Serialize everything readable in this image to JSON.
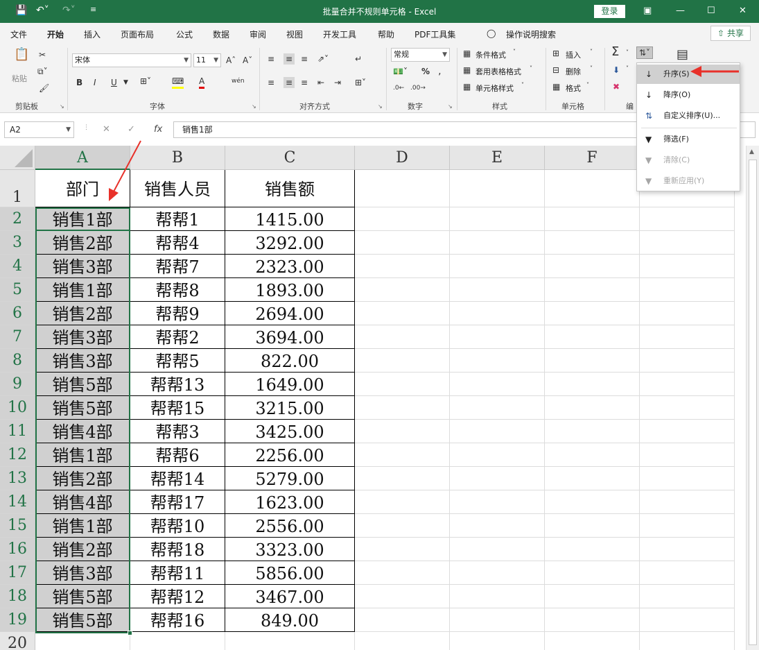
{
  "titlebar": {
    "title": "批量合并不规则单元格  -  Excel",
    "login": "登录"
  },
  "menu": {
    "tabs": [
      "文件",
      "开始",
      "插入",
      "页面布局",
      "公式",
      "数据",
      "审阅",
      "视图",
      "开发工具",
      "帮助",
      "PDF工具集"
    ],
    "tell_me": "操作说明搜索",
    "share": "共享"
  },
  "ribbon": {
    "clipboard": {
      "paste": "粘贴",
      "label": "剪贴板"
    },
    "font": {
      "name": "宋体",
      "size": "11",
      "label": "字体",
      "bold": "B",
      "italic": "I",
      "underline": "U"
    },
    "alignment": {
      "label": "对齐方式"
    },
    "number": {
      "format": "常规",
      "label": "数字",
      "percent": "%"
    },
    "styles": {
      "conditional": "条件格式",
      "table": "套用表格格式",
      "cell": "单元格样式",
      "label": "样式"
    },
    "cells": {
      "insert": "插入",
      "delete": "删除",
      "format": "格式",
      "label": "单元格"
    },
    "editing": {
      "label": "编"
    }
  },
  "formula_bar": {
    "cell_ref": "A2",
    "fx": "fx",
    "content": "销售1部"
  },
  "sort_menu": {
    "ascending": "升序(S)",
    "descending": "降序(O)",
    "custom": "自定义排序(U)...",
    "filter": "筛选(F)",
    "clear": "清除(C)",
    "reapply": "重新应用(Y)"
  },
  "sheet": {
    "columns": [
      "A",
      "B",
      "C",
      "D",
      "E",
      "F"
    ],
    "row_numbers": [
      "1",
      "2",
      "3",
      "4",
      "5",
      "6",
      "7",
      "8",
      "9",
      "10",
      "11",
      "12",
      "13",
      "14",
      "15",
      "16",
      "17",
      "18",
      "19",
      "20"
    ],
    "header": [
      "部门",
      "销售人员",
      "销售额"
    ],
    "rows": [
      [
        "销售1部",
        "帮帮1",
        "1415.00"
      ],
      [
        "销售2部",
        "帮帮4",
        "3292.00"
      ],
      [
        "销售3部",
        "帮帮7",
        "2323.00"
      ],
      [
        "销售1部",
        "帮帮8",
        "1893.00"
      ],
      [
        "销售2部",
        "帮帮9",
        "2694.00"
      ],
      [
        "销售3部",
        "帮帮2",
        "3694.00"
      ],
      [
        "销售3部",
        "帮帮5",
        "822.00"
      ],
      [
        "销售5部",
        "帮帮13",
        "1649.00"
      ],
      [
        "销售5部",
        "帮帮15",
        "3215.00"
      ],
      [
        "销售4部",
        "帮帮3",
        "3425.00"
      ],
      [
        "销售1部",
        "帮帮6",
        "2256.00"
      ],
      [
        "销售2部",
        "帮帮14",
        "5279.00"
      ],
      [
        "销售4部",
        "帮帮17",
        "1623.00"
      ],
      [
        "销售1部",
        "帮帮10",
        "2556.00"
      ],
      [
        "销售2部",
        "帮帮18",
        "3323.00"
      ],
      [
        "销售3部",
        "帮帮11",
        "5856.00"
      ],
      [
        "销售5部",
        "帮帮12",
        "3467.00"
      ],
      [
        "销售5部",
        "帮帮16",
        "849.00"
      ]
    ]
  },
  "colors": {
    "excel_green": "#217346",
    "annotation_red": "#e8312a"
  }
}
